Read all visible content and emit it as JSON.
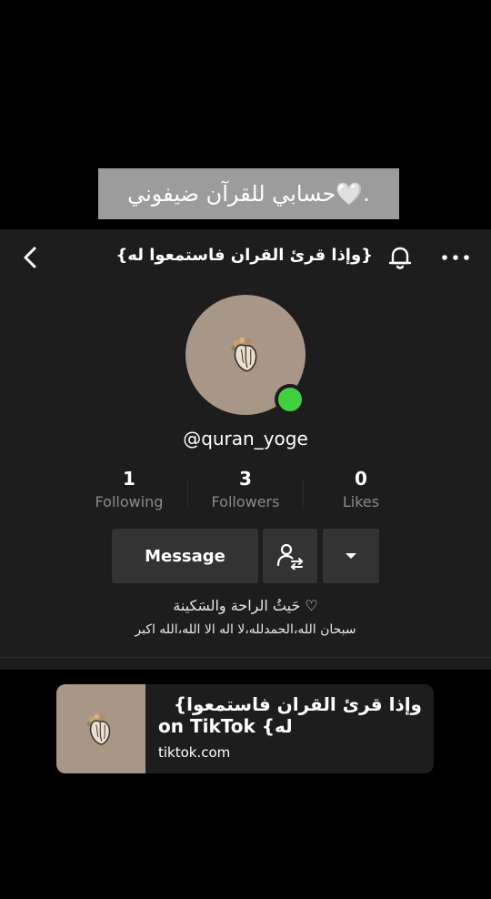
{
  "caption": "حسابي للقرآن ضيفوني🤍.",
  "header": {
    "title": "{وإذا قرئ القران فاستمعوا له}",
    "icons": {
      "back": "back-chevron-icon",
      "notifications": "bell-icon",
      "more": "more-dots-icon"
    }
  },
  "profile": {
    "username": "@quran_yoge",
    "avatar_icon": "anatomical-heart-with-flowers",
    "online": true,
    "online_color": "#3fd13f"
  },
  "stats": [
    {
      "value": "1",
      "label": "Following"
    },
    {
      "value": "3",
      "label": "Followers"
    },
    {
      "value": "0",
      "label": "Likes"
    }
  ],
  "actions": {
    "message_label": "Message",
    "follow_icon": "user-follow-swap-icon",
    "dropdown_icon": "caret-down-icon"
  },
  "bio": {
    "line1": "حَيثُ الراحة والسَكينة ♡",
    "line2": "سبحان الله،الحمدلله،لا اله الا الله،الله اكبر"
  },
  "link_preview": {
    "title_line1": "{وإذا قرئ القران فاستمعوا",
    "title_line2": "on TikTok {له",
    "domain": "tiktok.com"
  },
  "colors": {
    "background": "#000000",
    "panel": "#1d1d1d",
    "button": "#333333",
    "avatar_bg": "#a89686",
    "caption_bg": "#9c9c9c",
    "muted_text": "#8a8a8a"
  }
}
